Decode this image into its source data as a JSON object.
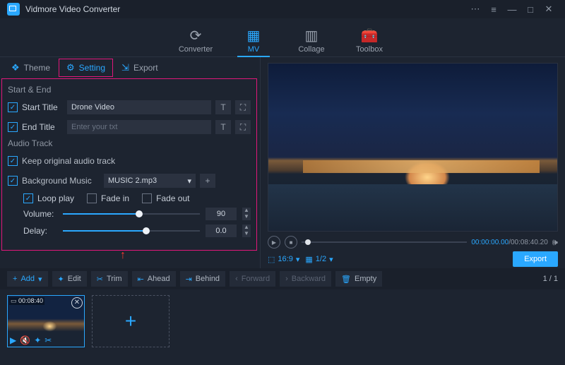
{
  "app": {
    "title": "Vidmore Video Converter"
  },
  "mainnav": [
    {
      "icon": "⟳",
      "label": "Converter"
    },
    {
      "icon": "▦",
      "label": "MV"
    },
    {
      "icon": "▥",
      "label": "Collage"
    },
    {
      "icon": "🧰",
      "label": "Toolbox"
    }
  ],
  "subtabs": {
    "theme": "Theme",
    "setting": "Setting",
    "export": "Export"
  },
  "settings": {
    "start_end": {
      "title": "Start & End",
      "start_label": "Start Title",
      "start_value": "Drone Video",
      "end_label": "End Title",
      "end_placeholder": "Enter your txt"
    },
    "audio": {
      "title": "Audio Track",
      "keep_original": "Keep original audio track",
      "bg_music_label": "Background Music",
      "bg_music_value": "MUSIC 2.mp3",
      "loop": "Loop play",
      "fade_in": "Fade in",
      "fade_out": "Fade out",
      "volume_label": "Volume:",
      "volume_value": "90",
      "delay_label": "Delay:",
      "delay_value": "0.0"
    }
  },
  "preview": {
    "time_current": "00:00:00.00",
    "time_total": "/00:08:40.20",
    "aspect": "16:9",
    "page": "1/2",
    "export": "Export"
  },
  "toolbar": {
    "add": "Add",
    "edit": "Edit",
    "trim": "Trim",
    "ahead": "Ahead",
    "behind": "Behind",
    "forward": "Forward",
    "backward": "Backward",
    "empty": "Empty",
    "page": "1 / 1"
  },
  "clip": {
    "duration": "00:08:40"
  },
  "icons": {
    "plus": "+",
    "caret": "▾",
    "check": "✓"
  }
}
